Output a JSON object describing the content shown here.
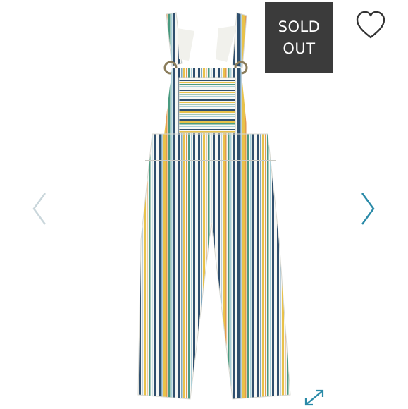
{
  "product": {
    "image_icon": "striped-overalls-image",
    "stripe_colors": [
      "#2f4f6e",
      "#e8c24a",
      "#4a9a80",
      "#e59b4e",
      "#a9cfd8"
    ]
  },
  "badge": {
    "line1": "SOLD",
    "line2": "OUT",
    "color": "#3b3b3b"
  },
  "controls": {
    "wishlist_icon": "heart-outline-icon",
    "prev_icon": "chevron-left-icon",
    "next_icon": "chevron-right-icon",
    "expand_icon": "expand-arrows-icon",
    "prev_color": "#c9d6db",
    "next_color": "#2a8aa8",
    "expand_color": "#2a8aa8"
  }
}
